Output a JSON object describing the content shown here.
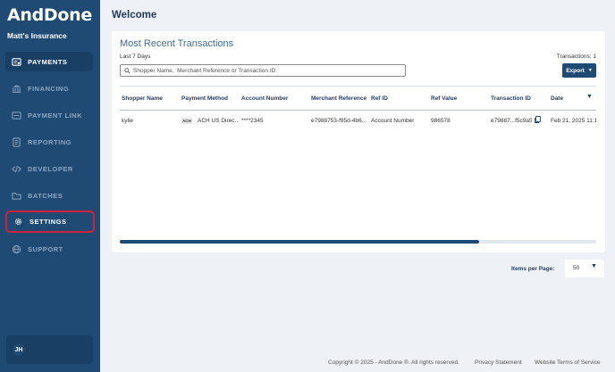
{
  "sidebar": {
    "logo": "AndDone",
    "org_name": "Matt's Insurance",
    "items": [
      {
        "label": "PAYMENTS",
        "icon": "payments-icon"
      },
      {
        "label": "FINANCING",
        "icon": "bank-icon"
      },
      {
        "label": "PAYMENT LINK",
        "icon": "link-icon"
      },
      {
        "label": "REPORTING",
        "icon": "report-icon"
      },
      {
        "label": "DEVELOPER",
        "icon": "code-icon"
      },
      {
        "label": "BATCHES",
        "icon": "folder-icon"
      },
      {
        "label": "SETTINGS",
        "icon": "gear-icon"
      },
      {
        "label": "SUPPORT",
        "icon": "globe-icon"
      }
    ],
    "user_initials": "JH"
  },
  "main": {
    "title": "Welcome",
    "card": {
      "title": "Most Recent Transactions",
      "period": "Last 7 Days",
      "transactions_count": "Transactions: 1",
      "search_placeholder": "Shopper Name,  Merchant Reference or Transaction ID",
      "export_label": "Export",
      "columns": [
        "Shopper Name",
        "Payment Method",
        "Account Number",
        "Merchant Reference",
        "Ref ID",
        "Ref Value",
        "Transaction ID",
        "Date"
      ],
      "rows": [
        {
          "shopper_name": "kylie",
          "payment_logo": "ACH",
          "payment_method": "ACH US Direc...",
          "account_number": "****2345",
          "merchant_reference": "e7988753-f95d-4b6...",
          "ref_id": "Account Number",
          "ref_value": "986578",
          "transaction_id": "e79887...f5c9a5",
          "date": "Feb 21, 2025 11:1"
        }
      ],
      "scroll_position": 0.75
    },
    "pagination": {
      "items_per_page_label": "Items per Page:",
      "items_per_page_value": "50"
    }
  },
  "footer": {
    "copyright": "Copyright © 2025 - AndDone ®. All rights reserved.",
    "privacy": "Privacy Statement",
    "terms": "Website Terms of Service"
  },
  "colors": {
    "sidebar_bg": "#1e4a74",
    "accent": "#1e4a74",
    "highlight_border": "#d0213b",
    "page_bg": "#eef1f5"
  }
}
